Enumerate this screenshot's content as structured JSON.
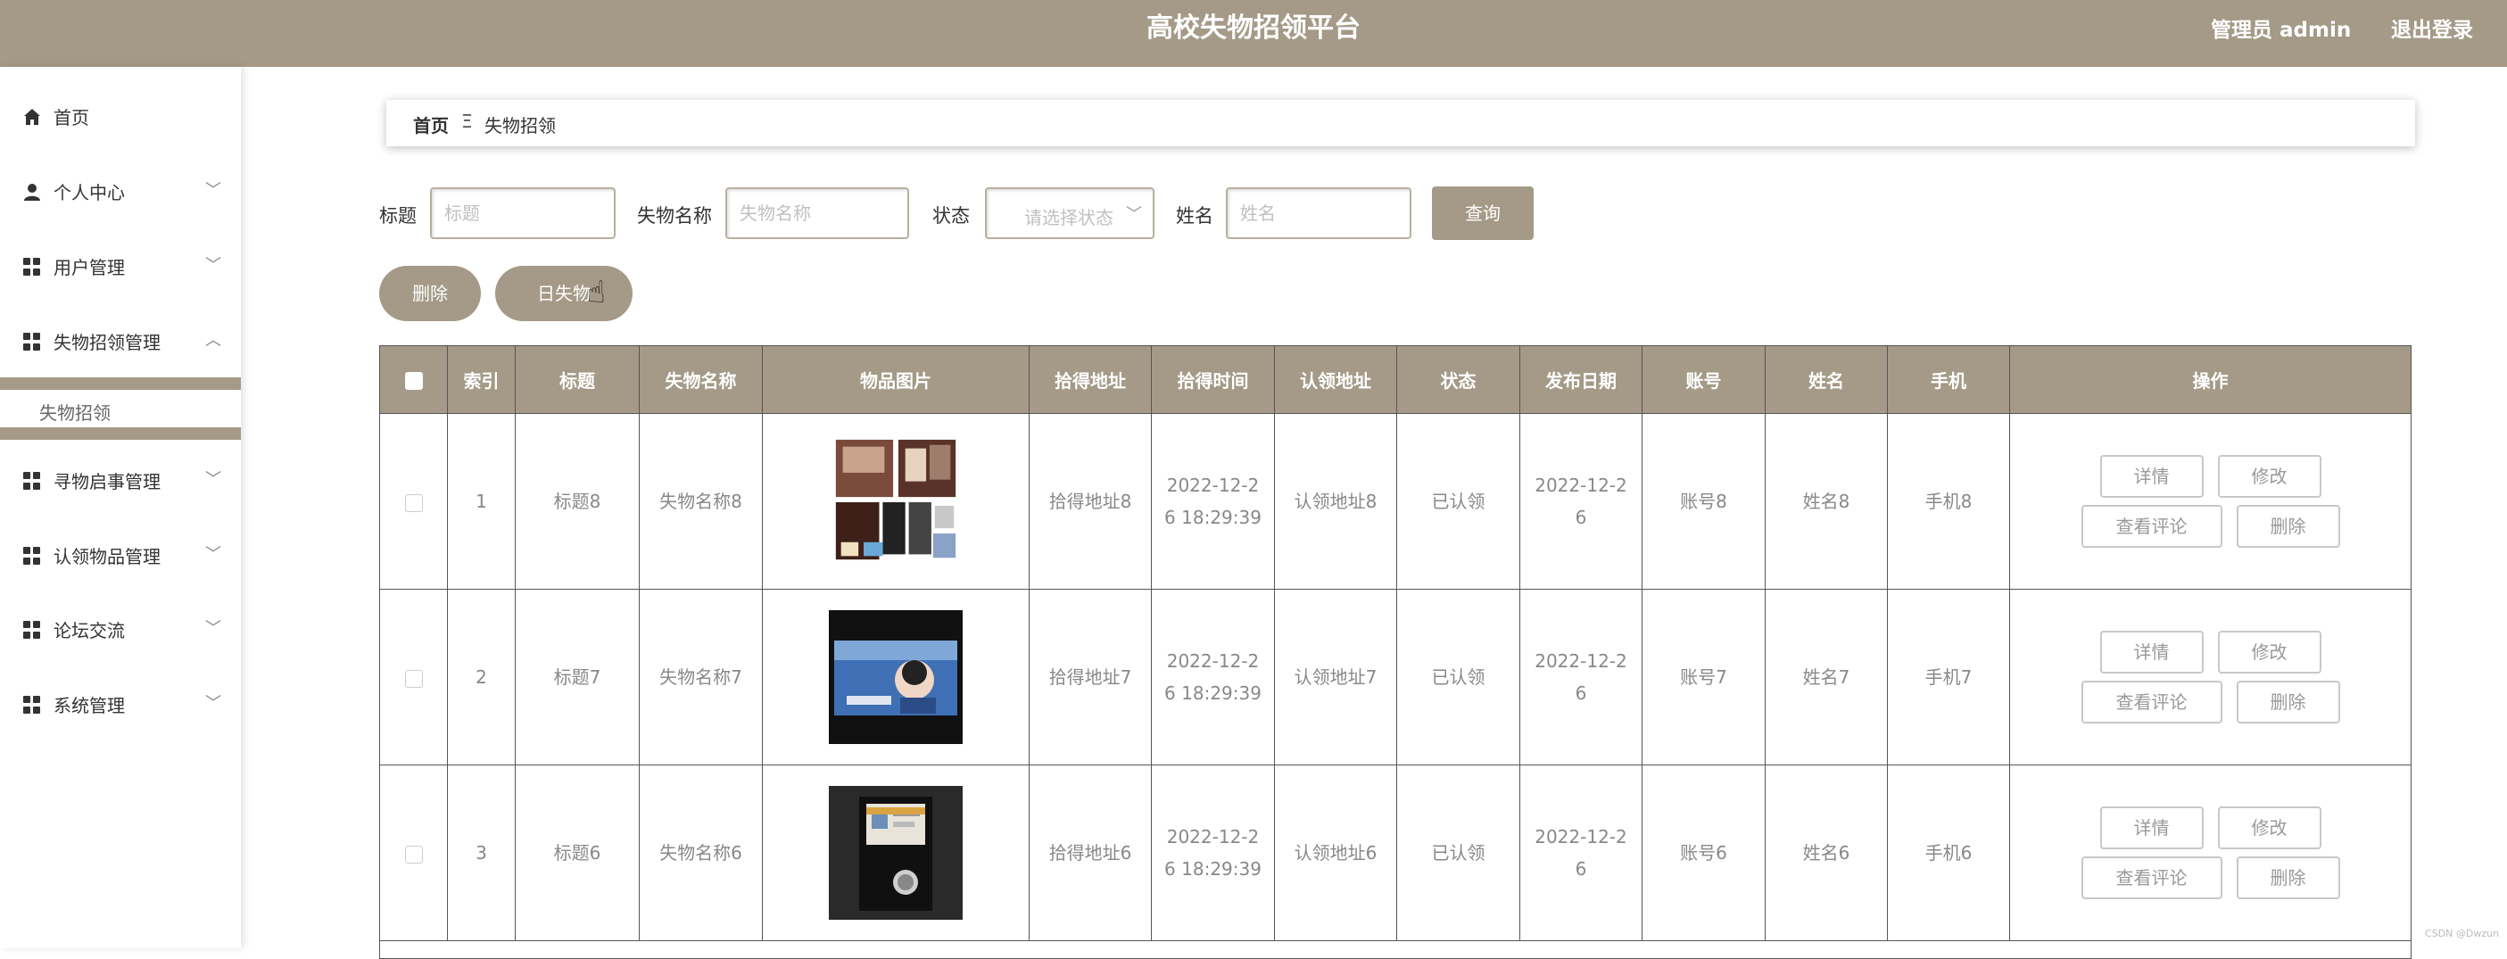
{
  "header": {
    "title": "高校失物招领平台",
    "admin": "管理员 admin",
    "logout": "退出登录"
  },
  "sidebar": {
    "items": [
      {
        "label": "首页",
        "icon": "home-icon"
      },
      {
        "label": "个人中心",
        "icon": "user-icon"
      },
      {
        "label": "用户管理",
        "icon": "grid-icon"
      },
      {
        "label": "失物招领管理",
        "icon": "grid-icon"
      },
      {
        "label": "寻物启事管理",
        "icon": "grid-icon"
      },
      {
        "label": "认领物品管理",
        "icon": "grid-icon"
      },
      {
        "label": "论坛交流",
        "icon": "grid-icon"
      },
      {
        "label": "系统管理",
        "icon": "grid-icon"
      }
    ],
    "submenu": "失物招领"
  },
  "breadcrumb": {
    "home": "首页",
    "separator": "Ξ",
    "current": "失物招领"
  },
  "search": {
    "title_label": "标题",
    "title_placeholder": "标题",
    "name_label": "失物名称",
    "name_placeholder": "失物名称",
    "status_label": "状态",
    "status_placeholder": "请选择状态",
    "person_label": "姓名",
    "person_placeholder": "姓名",
    "query": "查询"
  },
  "actions": {
    "delete": "删除",
    "export": "日失物"
  },
  "table": {
    "headers": [
      "索引",
      "标题",
      "失物名称",
      "物品图片",
      "拾得地址",
      "拾得时间",
      "认领地址",
      "状态",
      "发布日期",
      "账号",
      "姓名",
      "手机",
      "操作"
    ],
    "rows": [
      {
        "index": "1",
        "title": "标题8",
        "name": "失物名称8",
        "address": "拾得地址8",
        "time_a": "2022-12-2",
        "time_b": "6 18:29:39",
        "claim": "认领地址8",
        "status": "已认领",
        "date_a": "2022-12-2",
        "date_b": "6",
        "account": "账号8",
        "person": "姓名8",
        "phone": "手机8"
      },
      {
        "index": "2",
        "title": "标题7",
        "name": "失物名称7",
        "address": "拾得地址7",
        "time_a": "2022-12-2",
        "time_b": "6 18:29:39",
        "claim": "认领地址7",
        "status": "已认领",
        "date_a": "2022-12-2",
        "date_b": "6",
        "account": "账号7",
        "person": "姓名7",
        "phone": "手机7"
      },
      {
        "index": "3",
        "title": "标题6",
        "name": "失物名称6",
        "address": "拾得地址6",
        "time_a": "2022-12-2",
        "time_b": "6 18:29:39",
        "claim": "认领地址6",
        "status": "已认领",
        "date_a": "2022-12-2",
        "date_b": "6",
        "account": "账号6",
        "person": "姓名6",
        "phone": "手机6"
      }
    ],
    "ops": {
      "detail": "详情",
      "edit": "修改",
      "comments": "查看评论",
      "delete": "删除"
    }
  },
  "watermark": "CSDN @Dwzun",
  "colors": {
    "accent": "#a49a87"
  }
}
